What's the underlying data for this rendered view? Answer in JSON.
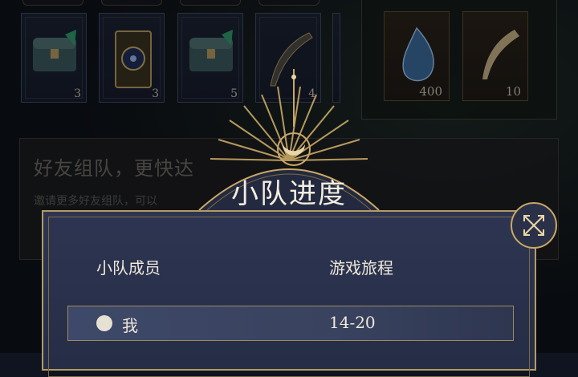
{
  "cards": [
    {
      "name": "treasure-chest",
      "count": "3"
    },
    {
      "name": "tarot-card",
      "count": "3"
    },
    {
      "name": "treasure-chest",
      "count": "5"
    },
    {
      "name": "quill-feather",
      "count": "4"
    }
  ],
  "right_cards": [
    {
      "name": "blue-gem",
      "count": "400"
    },
    {
      "name": "golden-feather",
      "count": "10"
    }
  ],
  "banner": {
    "title": "好友组队，更快达",
    "subtitle": "邀请更多好友组队，可以"
  },
  "modal": {
    "title": "小队进度",
    "col_member": "小队成员",
    "col_progress": "游戏旅程",
    "rows": [
      {
        "name": "我",
        "progress": "14-20"
      }
    ]
  },
  "colors": {
    "gold": "#c9a865",
    "panel": "#2d3552"
  }
}
